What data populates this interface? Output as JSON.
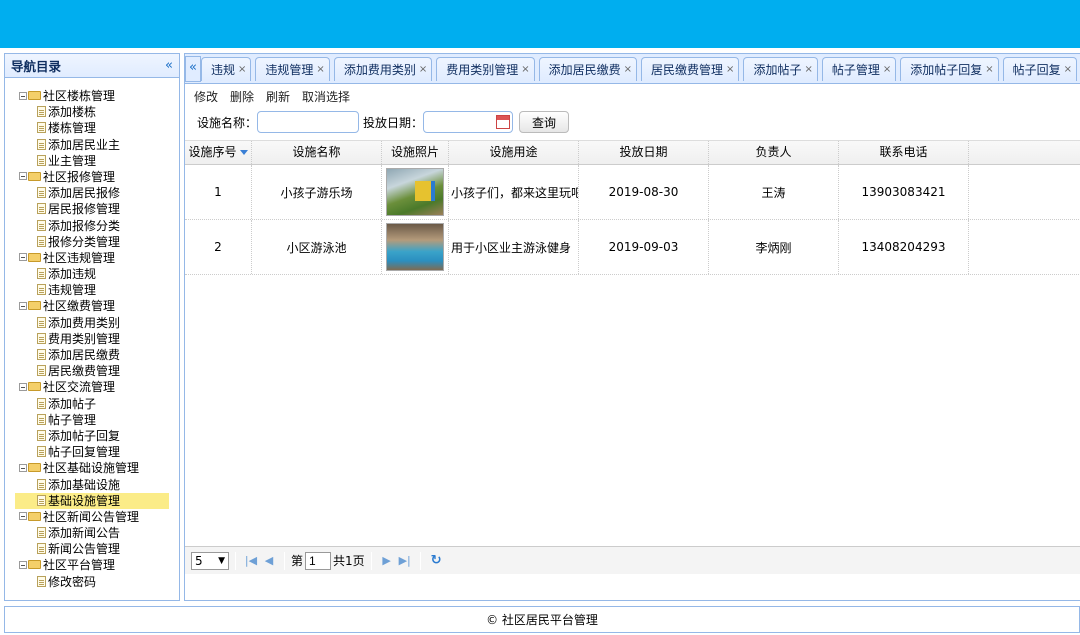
{
  "nav": {
    "title": "导航目录",
    "collapse_glyph": "«",
    "tree": [
      {
        "label": "社区楼栋管理",
        "children": [
          "添加楼栋",
          "楼栋管理",
          "添加居民业主",
          "业主管理"
        ]
      },
      {
        "label": "社区报修管理",
        "children": [
          "添加居民报修",
          "居民报修管理",
          "添加报修分类",
          "报修分类管理"
        ]
      },
      {
        "label": "社区违规管理",
        "children": [
          "添加违规",
          "违规管理"
        ]
      },
      {
        "label": "社区缴费管理",
        "children": [
          "添加费用类别",
          "费用类别管理",
          "添加居民缴费",
          "居民缴费管理"
        ]
      },
      {
        "label": "社区交流管理",
        "children": [
          "添加帖子",
          "帖子管理",
          "添加帖子回复",
          "帖子回复管理"
        ]
      },
      {
        "label": "社区基础设施管理",
        "children": [
          "添加基础设施",
          "基础设施管理"
        ]
      },
      {
        "label": "社区新闻公告管理",
        "children": [
          "添加新闻公告",
          "新闻公告管理"
        ]
      },
      {
        "label": "社区平台管理",
        "children": [
          "修改密码"
        ]
      }
    ],
    "selected": "基础设施管理"
  },
  "tabs": {
    "scroll_left_glyph": "«",
    "close_glyph": "×",
    "items": [
      "违规",
      "违规管理",
      "添加费用类别",
      "费用类别管理",
      "添加居民缴费",
      "居民缴费管理",
      "添加帖子",
      "帖子管理",
      "添加帖子回复",
      "帖子回复"
    ]
  },
  "toolbar": {
    "edit": "修改",
    "delete": "删除",
    "refresh": "刷新",
    "deselect": "取消选择"
  },
  "search": {
    "name_label": "设施名称：",
    "date_label": "投放日期：",
    "query_button": "查询",
    "name_value": "",
    "date_value": ""
  },
  "grid": {
    "columns": [
      "设施序号",
      "设施名称",
      "设施照片",
      "设施用途",
      "投放日期",
      "负责人",
      "联系电话"
    ],
    "rows": [
      {
        "id": "1",
        "name": "小孩子游乐场",
        "photo": "playground",
        "usage": "小孩子们，都来这里玩吧",
        "date": "2019-08-30",
        "owner": "王涛",
        "phone": "13903083421"
      },
      {
        "id": "2",
        "name": "小区游泳池",
        "photo": "pool",
        "usage": "用于小区业主游泳健身",
        "date": "2019-09-03",
        "owner": "李炳刚",
        "phone": "13408204293"
      }
    ]
  },
  "pager": {
    "page_size": "5",
    "page_prefix": "第",
    "page_value": "1",
    "page_suffix": "共1页"
  },
  "footer": {
    "text": "© 社区居民平台管理"
  },
  "colors": {
    "banner": "#00aeef",
    "panel_border": "#95b8e7",
    "selected_bg": "#fbec88"
  }
}
